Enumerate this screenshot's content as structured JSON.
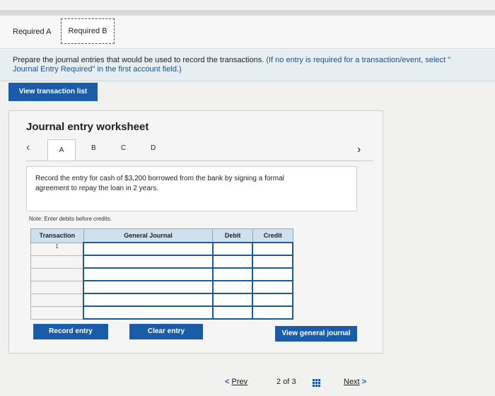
{
  "tabs": {
    "required_a": "Required A",
    "required_b": "Required B"
  },
  "instructions": {
    "text_main": "Prepare the journal entries that would be used to record the transactions. ",
    "text_note_line1": "(If no entry is required for a transaction/event, select \"",
    "text_note_line2": "Journal Entry Required\" in the first account field.)"
  },
  "buttons": {
    "view_transaction_list": "View transaction list",
    "record_entry": "Record entry",
    "clear_entry": "Clear entry",
    "view_general_journal": "View general journal"
  },
  "worksheet": {
    "title": "Journal entry worksheet",
    "subtabs": [
      "A",
      "B",
      "C",
      "D"
    ],
    "active_subtab": "A",
    "description": "Record the entry for cash of $3,200 borrowed from the bank by signing a formal agreement to repay the loan in 2 years.",
    "note": "Note: Enter debits before credits."
  },
  "journal_table": {
    "headers": {
      "transaction": "Transaction",
      "general_journal": "General Journal",
      "debit": "Debit",
      "credit": "Credit"
    },
    "first_transaction": "1"
  },
  "pager": {
    "prev": "Prev",
    "current": "2",
    "of_label": "of",
    "total": "3",
    "next": "Next"
  }
}
